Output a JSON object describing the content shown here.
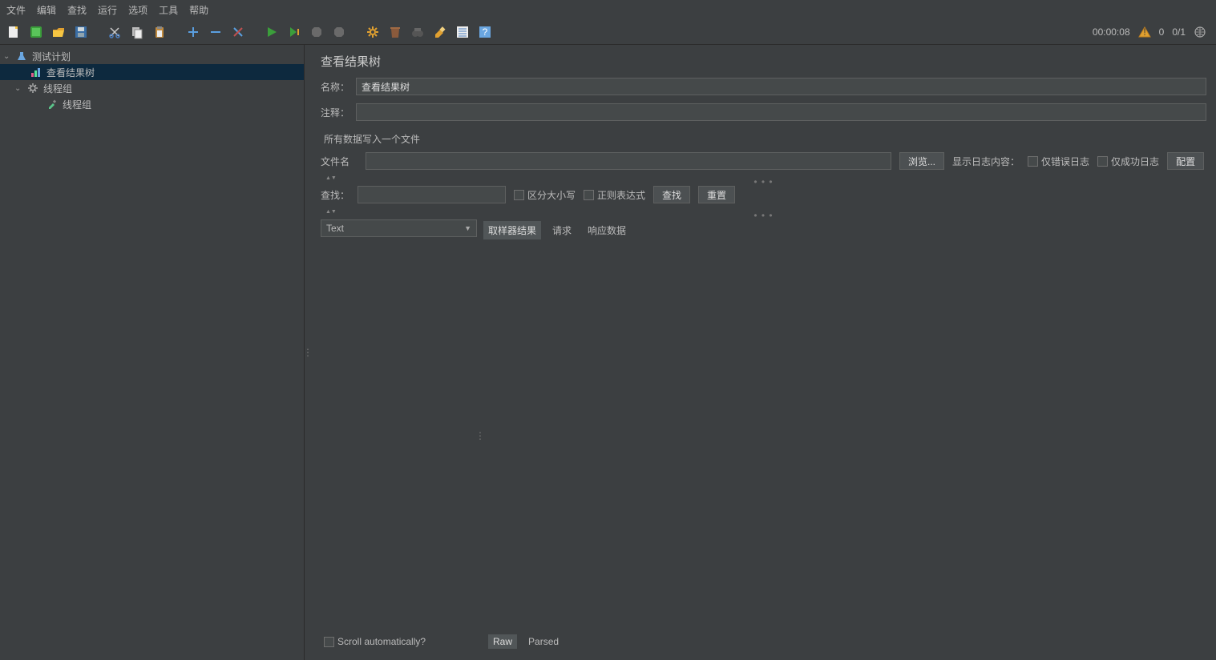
{
  "menu": {
    "items": [
      "文件",
      "编辑",
      "查找",
      "运行",
      "选项",
      "工具",
      "帮助"
    ]
  },
  "status": {
    "time": "00:00:08",
    "zero": "0",
    "ratio": "0/1"
  },
  "tree": {
    "root": {
      "label": "测试计划"
    },
    "n1": {
      "label": "查看结果树"
    },
    "n2": {
      "label": "线程组"
    },
    "n3": {
      "label": "线程组"
    }
  },
  "panel": {
    "title": "查看结果树",
    "name_label": "名称：",
    "name_value": "查看结果树",
    "comment_label": "注释：",
    "comment_value": "",
    "filesection": "所有数据写入一个文件",
    "filename_label": "文件名",
    "browse": "浏览...",
    "showlog": "显示日志内容：",
    "only_error": "仅错误日志",
    "only_success": "仅成功日志",
    "configure": "配置",
    "search_label": "查找：",
    "case_sensitive": "区分大小写",
    "regex": "正则表达式",
    "find": "查找",
    "reset": "重置",
    "dropdown": "Text",
    "scroll_auto": "Scroll automatically?",
    "tabs": {
      "t1": "取样器结果",
      "t2": "请求",
      "t3": "响应数据"
    },
    "subtabs": {
      "raw": "Raw",
      "parsed": "Parsed"
    }
  }
}
